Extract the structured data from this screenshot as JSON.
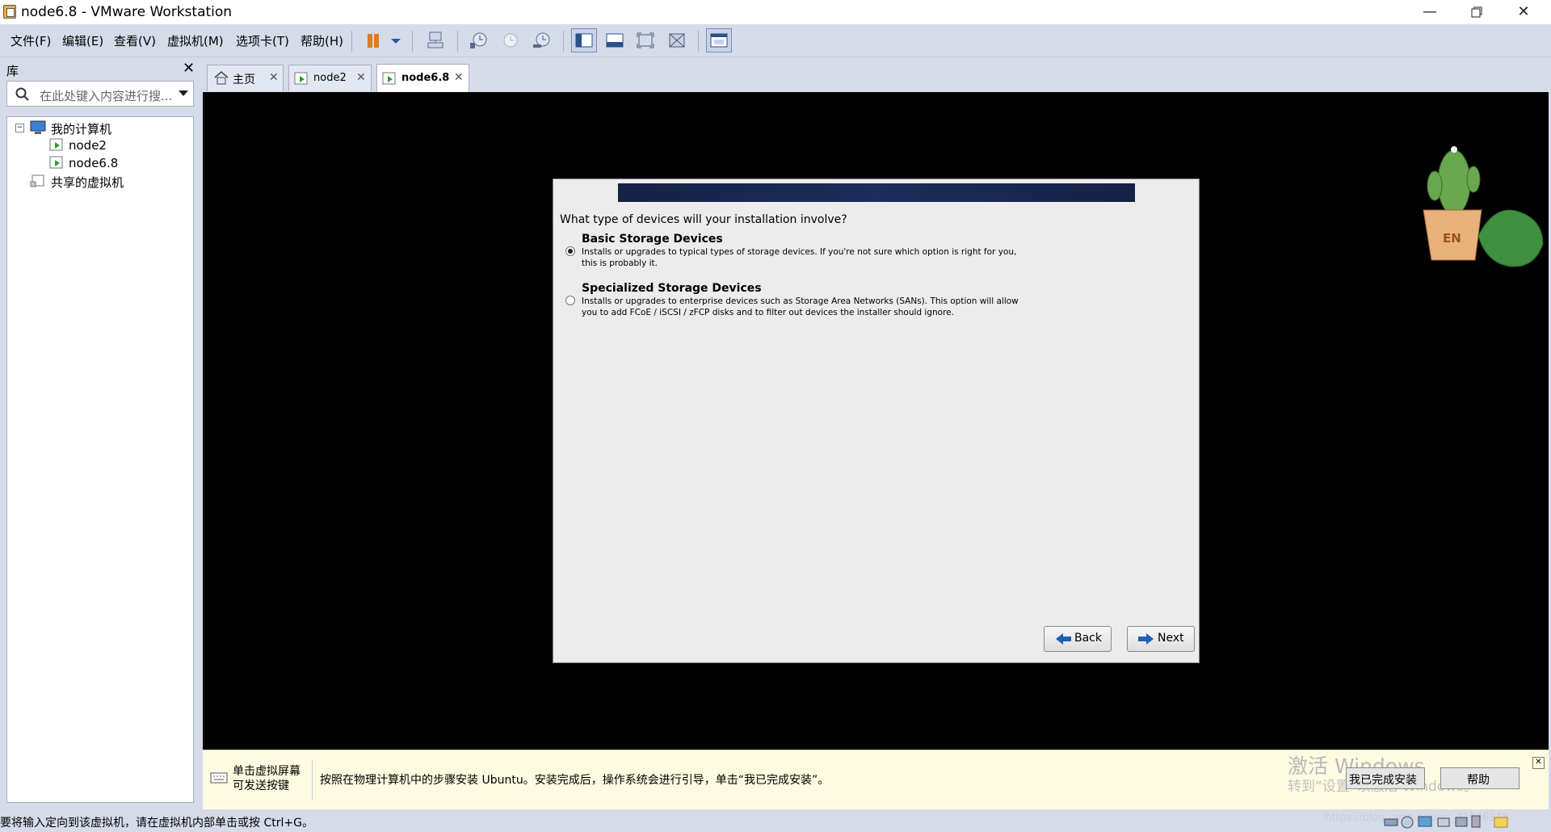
{
  "window": {
    "title": "node6.8 - VMware Workstation"
  },
  "menu": [
    "文件(F)",
    "编辑(E)",
    "查看(V)",
    "虚拟机(M)",
    "选项卡(T)",
    "帮助(H)"
  ],
  "library": {
    "title": "库",
    "search_placeholder": "在此处键入内容进行搜...",
    "tree": {
      "root": "我的计算机",
      "vms": [
        "node2",
        "node6.8"
      ],
      "shared": "共享的虚拟机"
    }
  },
  "tabs": [
    {
      "label": "主页",
      "icon": "home-icon"
    },
    {
      "label": "node2",
      "icon": "vm-icon"
    },
    {
      "label": "node6.8",
      "icon": "vm-icon",
      "active": true
    }
  ],
  "installer": {
    "question": "What type of devices will your installation involve?",
    "options": [
      {
        "title": "Basic Storage Devices",
        "line1": "Installs or upgrades to typical types of storage devices.  If you're not sure which option is right for you,",
        "line2": "this is probably it.",
        "selected": true
      },
      {
        "title": "Specialized Storage Devices",
        "line1": "Installs or upgrades to enterprise devices such as Storage Area Networks (SANs). This option will allow",
        "line2": "you to add FCoE / iSCSI / zFCP disks and to filter out devices the installer should ignore.",
        "selected": false
      }
    ],
    "back_label": "Back",
    "next_label": "Next"
  },
  "widget": {
    "lang": "EN"
  },
  "notify": {
    "hint_line1": "单击虚拟屏幕",
    "hint_line2": "可发送按键",
    "message": "按照在物理计算机中的步骤安装 Ubuntu。安装完成后，操作系统会进行引导，单击“我已完成安装”。",
    "watermark1": "激活 Windows",
    "watermark2": "转到“设置”以激活 Windows。",
    "done_label": "我已完成安装",
    "help_label": "帮助"
  },
  "status": {
    "text": "要将输入定向到该虚拟机，请在虚拟机内部单击或按 Ctrl+G。",
    "url_watermark": "https://blog.csdn.net/qq_41946916"
  },
  "colors": {
    "chrome": "#d6dbe9",
    "banner": "#1b2d5c",
    "dialog": "#ececec",
    "notify": "#fdfbe0"
  }
}
